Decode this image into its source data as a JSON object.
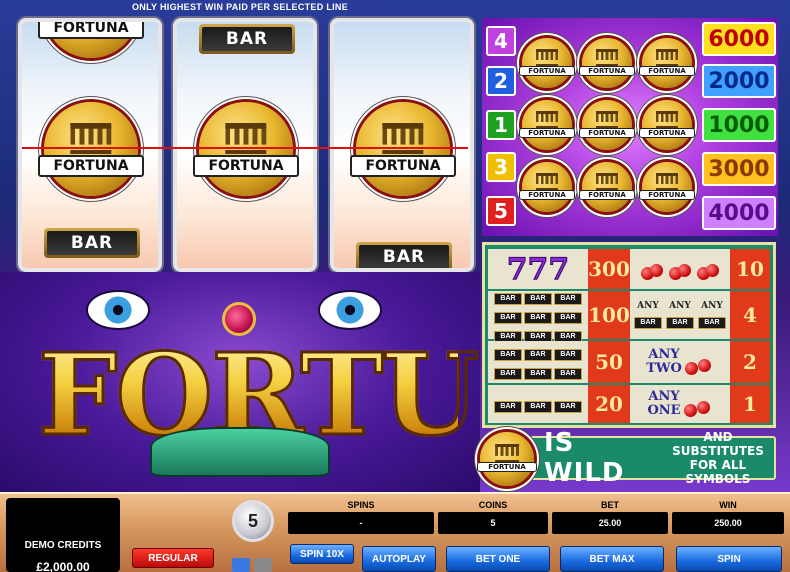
{
  "banner": "ONLY HIGHEST WIN PAID PER SELECTED LINE",
  "reels": {
    "bar_label": "BAR",
    "coin_label": "FORTUNA"
  },
  "paylines": [
    {
      "line": "4",
      "amount": "6000",
      "badge_color": "#c040e0",
      "amount_bg": "#ffe020",
      "amount_color": "#c00000"
    },
    {
      "line": "2",
      "amount": "2000",
      "badge_color": "#2060e0",
      "amount_bg": "#40a0ff",
      "amount_color": "#002a8a"
    },
    {
      "line": "1",
      "amount": "1000",
      "badge_color": "#20a020",
      "amount_bg": "#40e040",
      "amount_color": "#005a00"
    },
    {
      "line": "3",
      "amount": "3000",
      "badge_color": "#f0c000",
      "amount_bg": "#ffc020",
      "amount_color": "#8a3a00"
    },
    {
      "line": "5",
      "amount": "4000",
      "badge_color": "#e02020",
      "amount_bg": "#d080ff",
      "amount_color": "#5a0a8a"
    }
  ],
  "paytable": {
    "sevens": "777",
    "bar": "BAR",
    "any": "ANY",
    "any_two": [
      "ANY",
      "TWO"
    ],
    "any_one": [
      "ANY",
      "ONE"
    ],
    "rows": [
      {
        "left_pay": "300",
        "right_pay": "10"
      },
      {
        "left_pay": "100",
        "right_pay": "4"
      },
      {
        "left_pay": "50",
        "right_pay": "2"
      },
      {
        "left_pay": "20",
        "right_pay": "1"
      }
    ]
  },
  "wild": {
    "is_wild": "IS WILD",
    "sub1": "AND SUBSTITUTES",
    "sub2": "FOR ALL SYMBOLS"
  },
  "logo": "FORTUNA",
  "controls": {
    "demo_credits_label": "DEMO CREDITS",
    "demo_credits_value": "£2,000.00",
    "regular_label": "REGULAR",
    "chip_value": "5",
    "spins_label": "SPINS",
    "spins_value": "-",
    "coins_label": "COINS",
    "coins_value": "5",
    "bet_label": "BET",
    "bet_value": "25.00",
    "win_label": "WIN",
    "win_value": "250.00",
    "spin10x_label": "SPIN 10X",
    "autoplay_label": "AUTOPLAY",
    "bet_one_label": "BET ONE",
    "bet_max_label": "BET MAX",
    "spin_label": "SPIN"
  }
}
